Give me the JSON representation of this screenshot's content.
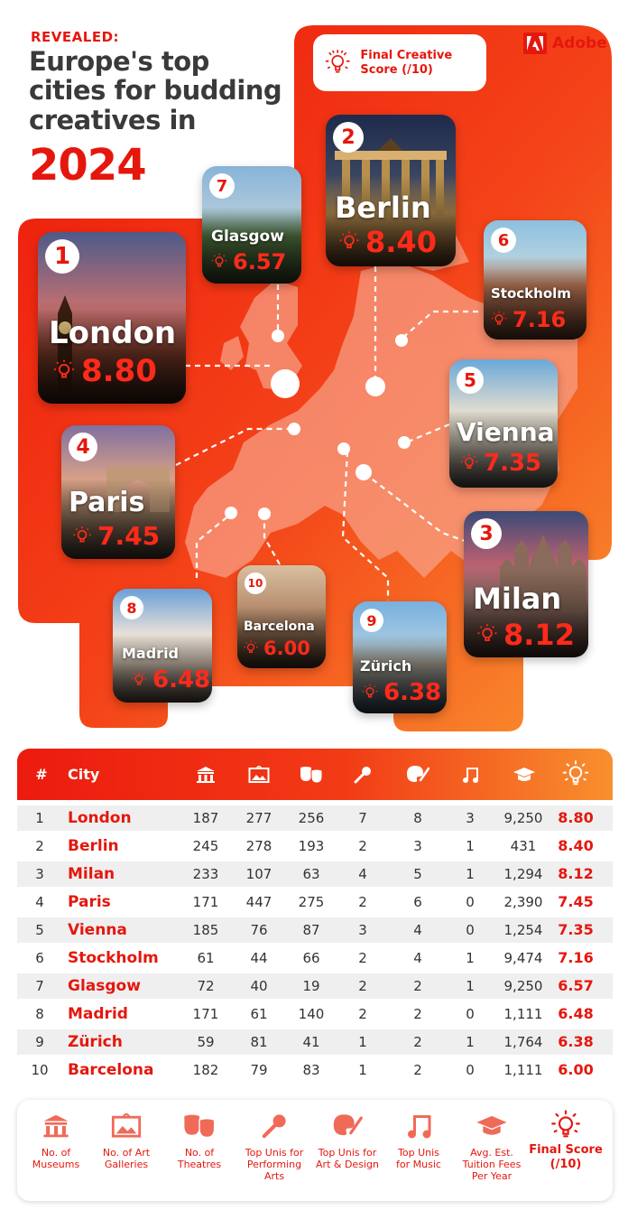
{
  "header": {
    "kicker": "REVEALED:",
    "headline": "Europe's top cities for budding creatives in",
    "year": "2024"
  },
  "brand": {
    "name": "Adobe"
  },
  "score_key": {
    "label": "Final Creative Score (/10)"
  },
  "colors": {
    "accent": "#e5170d",
    "gradient_start": "#ee1a0c",
    "gradient_end": "#f8902e"
  },
  "cards": [
    {
      "rank": "1",
      "city": "London",
      "score": "8.80"
    },
    {
      "rank": "2",
      "city": "Berlin",
      "score": "8.40"
    },
    {
      "rank": "3",
      "city": "Milan",
      "score": "8.12"
    },
    {
      "rank": "4",
      "city": "Paris",
      "score": "7.45"
    },
    {
      "rank": "5",
      "city": "Vienna",
      "score": "7.35"
    },
    {
      "rank": "6",
      "city": "Stockholm",
      "score": "7.16"
    },
    {
      "rank": "7",
      "city": "Glasgow",
      "score": "6.57"
    },
    {
      "rank": "8",
      "city": "Madrid",
      "score": "6.48"
    },
    {
      "rank": "9",
      "city": "Zürich",
      "score": "6.38"
    },
    {
      "rank": "10",
      "city": "Barcelona",
      "score": "6.00"
    }
  ],
  "table": {
    "columns": [
      {
        "label": "#"
      },
      {
        "label": "City"
      },
      {
        "icon": "museum-icon"
      },
      {
        "icon": "gallery-icon"
      },
      {
        "icon": "theatre-masks-icon"
      },
      {
        "icon": "microphone-icon"
      },
      {
        "icon": "palette-icon"
      },
      {
        "icon": "music-note-icon"
      },
      {
        "icon": "graduation-cap-icon"
      },
      {
        "icon": "lightbulb-icon"
      }
    ],
    "rows": [
      {
        "rank": "1",
        "city": "London",
        "museums": "187",
        "galleries": "277",
        "theatres": "256",
        "perf": "7",
        "art": "8",
        "music": "3",
        "fees": "9,250",
        "final": "8.80"
      },
      {
        "rank": "2",
        "city": "Berlin",
        "museums": "245",
        "galleries": "278",
        "theatres": "193",
        "perf": "2",
        "art": "3",
        "music": "1",
        "fees": "431",
        "final": "8.40"
      },
      {
        "rank": "3",
        "city": "Milan",
        "museums": "233",
        "galleries": "107",
        "theatres": "63",
        "perf": "4",
        "art": "5",
        "music": "1",
        "fees": "1,294",
        "final": "8.12"
      },
      {
        "rank": "4",
        "city": "Paris",
        "museums": "171",
        "galleries": "447",
        "theatres": "275",
        "perf": "2",
        "art": "6",
        "music": "0",
        "fees": "2,390",
        "final": "7.45"
      },
      {
        "rank": "5",
        "city": "Vienna",
        "museums": "185",
        "galleries": "76",
        "theatres": "87",
        "perf": "3",
        "art": "4",
        "music": "0",
        "fees": "1,254",
        "final": "7.35"
      },
      {
        "rank": "6",
        "city": "Stockholm",
        "museums": "61",
        "galleries": "44",
        "theatres": "66",
        "perf": "2",
        "art": "4",
        "music": "1",
        "fees": "9,474",
        "final": "7.16"
      },
      {
        "rank": "7",
        "city": "Glasgow",
        "museums": "72",
        "galleries": "40",
        "theatres": "19",
        "perf": "2",
        "art": "2",
        "music": "1",
        "fees": "9,250",
        "final": "6.57"
      },
      {
        "rank": "8",
        "city": "Madrid",
        "museums": "171",
        "galleries": "61",
        "theatres": "140",
        "perf": "2",
        "art": "2",
        "music": "0",
        "fees": "1,111",
        "final": "6.48"
      },
      {
        "rank": "9",
        "city": "Zürich",
        "museums": "59",
        "galleries": "81",
        "theatres": "41",
        "perf": "1",
        "art": "2",
        "music": "1",
        "fees": "1,764",
        "final": "6.38"
      },
      {
        "rank": "10",
        "city": "Barcelona",
        "museums": "182",
        "galleries": "79",
        "theatres": "83",
        "perf": "1",
        "art": "2",
        "music": "0",
        "fees": "1,111",
        "final": "6.00"
      }
    ]
  },
  "legend": [
    {
      "icon": "museum-icon",
      "label": "No. of Museums"
    },
    {
      "icon": "gallery-icon",
      "label": "No. of Art Galleries"
    },
    {
      "icon": "theatre-masks-icon",
      "label": "No. of Theatres"
    },
    {
      "icon": "microphone-icon",
      "label": "Top Unis for Performing Arts"
    },
    {
      "icon": "palette-icon",
      "label": "Top Unis for Art & Design"
    },
    {
      "icon": "music-note-icon",
      "label": "Top Unis for Music"
    },
    {
      "icon": "graduation-cap-icon",
      "label": "Avg. Est. Tuition Fees Per Year"
    },
    {
      "icon": "lightbulb-icon",
      "label": "Final Score (/10)"
    }
  ]
}
